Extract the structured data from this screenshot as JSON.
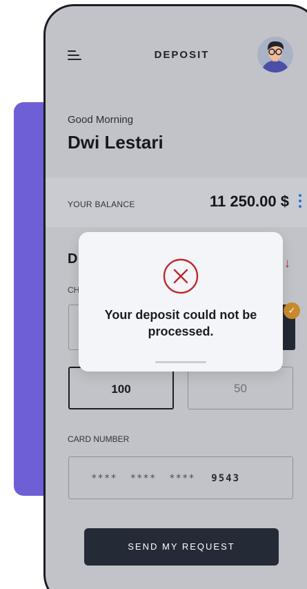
{
  "header": {
    "title": "DEPOSIT",
    "menu_icon": "hamburger-icon",
    "avatar_icon": "user-avatar"
  },
  "greeting": {
    "salutation": "Good Morning",
    "name": "Dwi Lestari"
  },
  "balance": {
    "label": "YOUR BALANCE",
    "value": "11 250.00 $"
  },
  "deposit_section": {
    "heading_visible": "D",
    "label_visible": "CH"
  },
  "amounts": {
    "selected": "100",
    "other": "50"
  },
  "card": {
    "label": "CARD NUMBER",
    "mask": "****  ****  ****",
    "last4": "9543"
  },
  "actions": {
    "send_label": "SEND MY REQUEST"
  },
  "error_modal": {
    "message": "Your deposit could not be processed.",
    "icon": "error-x-icon"
  },
  "colors": {
    "accent_purple": "#6f5fd6",
    "error_red": "#c0272d",
    "button_dark": "#242a36",
    "menu_blue": "#2a6fd6"
  }
}
